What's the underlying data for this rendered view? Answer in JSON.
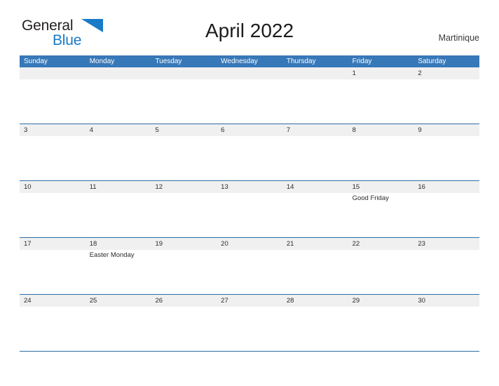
{
  "brand": {
    "word_one": "General",
    "word_two": "Blue",
    "flag_icon": "blue-flag-triangle",
    "color_dark": "#231f20",
    "color_blue": "#1a7bc7"
  },
  "header": {
    "title": "April 2022",
    "region": "Martinique"
  },
  "theme": {
    "header_blue": "#3778b8",
    "row_divider_blue": "#2d6ca8",
    "band_gray": "#f0f0f0",
    "text_dark": "#2b2b2b",
    "page_background": "#ffffff"
  },
  "calendar": {
    "month": "April",
    "year": "2022",
    "weekdays": [
      "Sunday",
      "Monday",
      "Tuesday",
      "Wednesday",
      "Thursday",
      "Friday",
      "Saturday"
    ],
    "weeks": [
      {
        "days": [
          {
            "number": "",
            "events": []
          },
          {
            "number": "",
            "events": []
          },
          {
            "number": "",
            "events": []
          },
          {
            "number": "",
            "events": []
          },
          {
            "number": "",
            "events": []
          },
          {
            "number": "1",
            "events": []
          },
          {
            "number": "2",
            "events": []
          }
        ]
      },
      {
        "days": [
          {
            "number": "3",
            "events": []
          },
          {
            "number": "4",
            "events": []
          },
          {
            "number": "5",
            "events": []
          },
          {
            "number": "6",
            "events": []
          },
          {
            "number": "7",
            "events": []
          },
          {
            "number": "8",
            "events": []
          },
          {
            "number": "9",
            "events": []
          }
        ]
      },
      {
        "days": [
          {
            "number": "10",
            "events": []
          },
          {
            "number": "11",
            "events": []
          },
          {
            "number": "12",
            "events": []
          },
          {
            "number": "13",
            "events": []
          },
          {
            "number": "14",
            "events": []
          },
          {
            "number": "15",
            "events": [
              "Good Friday"
            ]
          },
          {
            "number": "16",
            "events": []
          }
        ]
      },
      {
        "days": [
          {
            "number": "17",
            "events": []
          },
          {
            "number": "18",
            "events": [
              "Easter Monday"
            ]
          },
          {
            "number": "19",
            "events": []
          },
          {
            "number": "20",
            "events": []
          },
          {
            "number": "21",
            "events": []
          },
          {
            "number": "22",
            "events": []
          },
          {
            "number": "23",
            "events": []
          }
        ]
      },
      {
        "days": [
          {
            "number": "24",
            "events": []
          },
          {
            "number": "25",
            "events": []
          },
          {
            "number": "26",
            "events": []
          },
          {
            "number": "27",
            "events": []
          },
          {
            "number": "28",
            "events": []
          },
          {
            "number": "29",
            "events": []
          },
          {
            "number": "30",
            "events": []
          }
        ]
      }
    ]
  }
}
